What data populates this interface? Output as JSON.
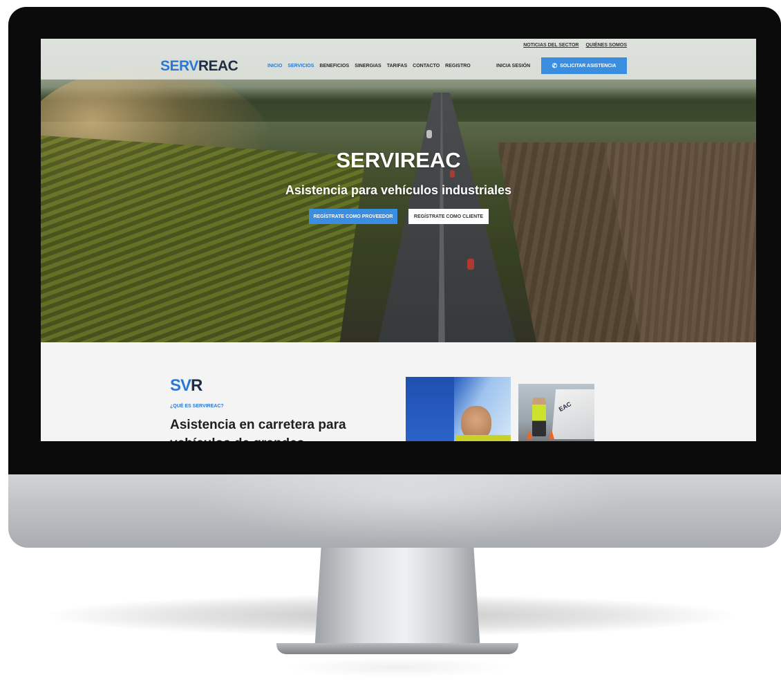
{
  "header": {
    "top_links": [
      "NOTICIAS DEL SECTOR",
      "QUIÉNES SOMOS"
    ],
    "logo": {
      "part1": "SERV",
      "part2": "REAC"
    },
    "nav": [
      "INICIO",
      "SERVICIOS",
      "BENEFICIOS",
      "SINERGIAS",
      "TARIFAS",
      "CONTACTO",
      "REGISTRO"
    ],
    "nav_active": "SERVICIOS",
    "login": "INICIA SESIÓN",
    "cta": "SOLICITAR ASISTENCIA",
    "cta_icon": "phone-icon"
  },
  "hero": {
    "title": "SERVIREAC",
    "subtitle": "Asistencia para vehículos industriales",
    "btn_provider": "REGÍSTRATE COMO PROVEEDOR",
    "btn_client": "REGÍSTRATE COMO CLIENTE"
  },
  "about": {
    "logo": {
      "part1": "SV",
      "part2": "R"
    },
    "kicker": "¿QUÉ ES SERVIREAC?",
    "heading": "Asistencia en carretera para vehículos de grandes",
    "photo2_brand": "EAC"
  },
  "colors": {
    "accent": "#3b8de0",
    "brand_dark": "#1f2d45",
    "brand_blue": "#2b78d4"
  }
}
